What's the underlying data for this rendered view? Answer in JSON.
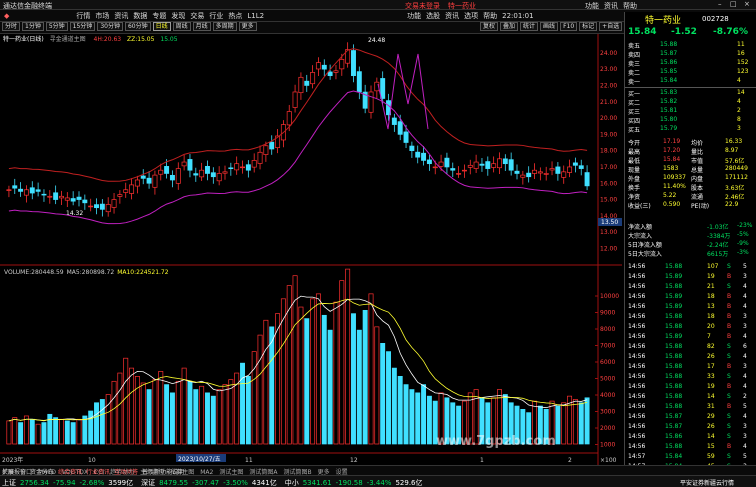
{
  "app": {
    "title": "通达信金融终端",
    "alert": "交易未登录",
    "stock_tag": "特一药业",
    "titlebar_right": [
      "功能",
      "资讯",
      "帮助"
    ]
  },
  "menu": [
    "行情",
    "市场",
    "资讯",
    "数据",
    "专题",
    "发现",
    "交易",
    "行业",
    "热点",
    "L1L2"
  ],
  "menu_right": [
    "功能",
    "选股",
    "资讯",
    "选项",
    "帮助"
  ],
  "clock": "22:01:01",
  "toolbar": {
    "periods": [
      "分时",
      "1分钟",
      "5分钟",
      "15分钟",
      "30分钟",
      "60分钟",
      "日线",
      "周线",
      "月线",
      "多周期",
      "更多"
    ],
    "active_period": "日线",
    "right_buttons": [
      "复权",
      "叠加",
      "统计",
      "画线",
      "F10",
      "标记",
      "+自选",
      "返回"
    ]
  },
  "chart_header": {
    "name": "特一药业(日线)",
    "template": "寻金通道主图",
    "items": [
      {
        "label": "4H:",
        "value": "20.63"
      },
      {
        "label": "ZZ:",
        "value": "15.05"
      },
      {
        "label": "",
        "value": "15.05"
      }
    ]
  },
  "price_axis": [
    "24.00",
    "23.00",
    "22.00",
    "21.00",
    "20.00",
    "19.00",
    "18.00",
    "17.00",
    "16.00",
    "15.00",
    "14.00",
    "13.50",
    "13.00",
    "12.00"
  ],
  "price_annotations": {
    "high": "24.48",
    "low": "14.32",
    "current": "13.50"
  },
  "volume_header": {
    "label": "VOLUME:",
    "value": "280448.59",
    "ma5_label": "MA5:",
    "ma5_value": "280898.72",
    "ma10_label": "MA10:",
    "ma10_value": "224521.72"
  },
  "volume_axis": [
    "10000",
    "9000",
    "8000",
    "7000",
    "6000",
    "5000",
    "4000",
    "3000",
    "2000",
    "1000"
  ],
  "volume_unit": "×100",
  "date_labels": [
    "2023年",
    "10",
    "11",
    "12",
    "1",
    "2"
  ],
  "date_cursor": "2023/10/27/五",
  "quote": {
    "name": "特一药业",
    "code": "002728",
    "price": "15.84",
    "change": "-1.52",
    "pct": "-8.76%",
    "asks": [
      {
        "label": "卖五",
        "price": "15.88",
        "vol": "11"
      },
      {
        "label": "卖四",
        "price": "15.87",
        "vol": "16"
      },
      {
        "label": "卖三",
        "price": "15.86",
        "vol": "152"
      },
      {
        "label": "卖二",
        "price": "15.85",
        "vol": "123"
      },
      {
        "label": "卖一",
        "price": "15.84",
        "vol": "4"
      }
    ],
    "bids": [
      {
        "label": "买一",
        "price": "15.83",
        "vol": "14"
      },
      {
        "label": "买二",
        "price": "15.82",
        "vol": "4"
      },
      {
        "label": "买三",
        "price": "15.81",
        "vol": "2"
      },
      {
        "label": "买四",
        "price": "15.80",
        "vol": "8"
      },
      {
        "label": "买五",
        "price": "15.79",
        "vol": "3"
      }
    ],
    "stats": [
      {
        "l1": "今开",
        "v1": "17.19",
        "l2": "均价",
        "v2": "16.33"
      },
      {
        "l1": "最高",
        "v1": "17.20",
        "l2": "量比",
        "v2": "8.97"
      },
      {
        "l1": "最低",
        "v1": "15.84",
        "l2": "市值",
        "v2": "57.6亿"
      },
      {
        "l1": "现量",
        "v1": "1583",
        "l2": "总量",
        "v2": "280449"
      },
      {
        "l1": "外盘",
        "v1": "109337",
        "l2": "内盘",
        "v2": "171112"
      },
      {
        "l1": "换手",
        "v1": "11.40%",
        "l2": "股本",
        "v2": "3.63亿"
      },
      {
        "l1": "净资",
        "v1": "5.22",
        "l2": "流通",
        "v2": "2.46亿"
      },
      {
        "l1": "收益(三)",
        "v1": "0.590",
        "l2": "PE(动)",
        "v2": "22.9"
      }
    ],
    "flows": [
      {
        "label": "净流入额",
        "value": "-1.03亿",
        "pct": "-23%"
      },
      {
        "label": "大宗流入",
        "value": "-3384万",
        "pct": "-5%"
      },
      {
        "label": "5日净流入额",
        "value": "-2.24亿",
        "pct": "-9%"
      },
      {
        "label": "5日大宗流入",
        "value": "6615万",
        "pct": "-3%"
      }
    ],
    "ticks": [
      {
        "time": "14:56",
        "price": "15.88",
        "vol": "107",
        "dir": "S",
        "n": "5"
      },
      {
        "time": "14:56",
        "price": "15.89",
        "vol": "19",
        "dir": "B",
        "n": "3"
      },
      {
        "time": "14:56",
        "price": "15.88",
        "vol": "21",
        "dir": "S",
        "n": "4"
      },
      {
        "time": "14:56",
        "price": "15.89",
        "vol": "18",
        "dir": "B",
        "n": "4"
      },
      {
        "time": "14:56",
        "price": "15.89",
        "vol": "13",
        "dir": "B",
        "n": "4"
      },
      {
        "time": "14:56",
        "price": "15.88",
        "vol": "18",
        "dir": "B",
        "n": "3"
      },
      {
        "time": "14:56",
        "price": "15.88",
        "vol": "20",
        "dir": "B",
        "n": "3"
      },
      {
        "time": "14:56",
        "price": "15.89",
        "vol": "7",
        "dir": "B",
        "n": "4"
      },
      {
        "time": "14:56",
        "price": "15.88",
        "vol": "82",
        "dir": "S",
        "n": "6"
      },
      {
        "time": "14:56",
        "price": "15.88",
        "vol": "26",
        "dir": "S",
        "n": "4"
      },
      {
        "time": "14:56",
        "price": "15.88",
        "vol": "17",
        "dir": "B",
        "n": "3"
      },
      {
        "time": "14:56",
        "price": "15.88",
        "vol": "33",
        "dir": "S",
        "n": "4"
      },
      {
        "time": "14:56",
        "price": "15.88",
        "vol": "19",
        "dir": "B",
        "n": "4"
      },
      {
        "time": "14:56",
        "price": "15.88",
        "vol": "14",
        "dir": "S",
        "n": "2"
      },
      {
        "time": "14:56",
        "price": "15.88",
        "vol": "31",
        "dir": "B",
        "n": "5"
      },
      {
        "time": "14:56",
        "price": "15.87",
        "vol": "29",
        "dir": "S",
        "n": "4"
      },
      {
        "time": "14:56",
        "price": "15.87",
        "vol": "26",
        "dir": "S",
        "n": "3"
      },
      {
        "time": "14:56",
        "price": "15.86",
        "vol": "14",
        "dir": "S",
        "n": "3"
      },
      {
        "time": "14:56",
        "price": "15.88",
        "vol": "15",
        "dir": "B",
        "n": "4"
      },
      {
        "time": "14:57",
        "price": "15.84",
        "vol": "59",
        "dir": "S",
        "n": "5"
      },
      {
        "time": "14:57",
        "price": "15.84",
        "vol": "45",
        "dir": "S",
        "n": "3"
      }
    ]
  },
  "bottom_tabs": [
    "扩展",
    "窗口",
    "MACD",
    "VOL-TDX",
    "CCI",
    "趋势动力",
    "主力监控",
    "私募主图",
    "MA2",
    "测试主图",
    "测试筒图A",
    "测试筒图B",
    "更多",
    "设置"
  ],
  "bottom_tabs2": [
    "关联报价",
    "资金分布",
    "综合资讯",
    "行业资讯",
    "互动问答",
    "普及新功能说明"
  ],
  "status": {
    "indices": [
      {
        "name": "上证",
        "value": "2756.34",
        "chg": "-75.94",
        "pct": "-2.68%",
        "amt": "3599亿"
      },
      {
        "name": "深证",
        "value": "8479.55",
        "chg": "-307.47",
        "pct": "-3.50%",
        "amt": "4341亿"
      },
      {
        "name": "中小",
        "value": "5341.61",
        "chg": "-190.58",
        "pct": "-3.44%",
        "amt": "529.6亿"
      }
    ],
    "right": "平安证券新疆云行情"
  },
  "watermark": "www.7gpzb.com",
  "colors": {
    "up": "#ff3030",
    "down": "#40e0ff",
    "channel_upper": "#c02020",
    "channel_lower": "#c020c0",
    "ma5": "#ffffff",
    "ma10": "#ffff30"
  }
}
